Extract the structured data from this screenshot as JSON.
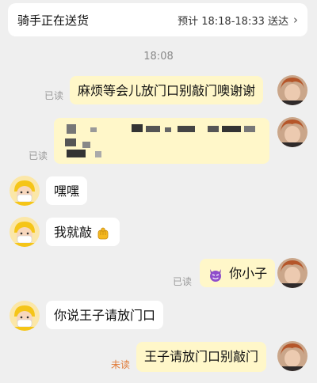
{
  "header": {
    "status": "骑手正在送货",
    "eta": "预计 18:18-18:33 送达",
    "chevron_icon": "chevron-right-icon"
  },
  "chat": {
    "timestamp": "18:08",
    "messages": [
      {
        "from": "me",
        "text": "麻烦等会儿放门口别敲门噢谢谢",
        "status": "已读"
      },
      {
        "from": "me",
        "text": "",
        "status": "已读",
        "redacted": true
      },
      {
        "from": "them",
        "text": "嘿嘿"
      },
      {
        "from": "them",
        "text": "我就敲",
        "emoji": "fist-icon"
      },
      {
        "from": "me",
        "text": "你小子",
        "status": "已读",
        "emoji": "devil-icon"
      },
      {
        "from": "them",
        "text": "你说王子请放门口"
      },
      {
        "from": "me",
        "text": "王子请放门口别敲门",
        "status": "未读"
      }
    ]
  },
  "colors": {
    "my_bubble": "#fff7c9",
    "their_bubble": "#ffffff",
    "unread": "#e07b39",
    "read": "#9a9a9a"
  }
}
